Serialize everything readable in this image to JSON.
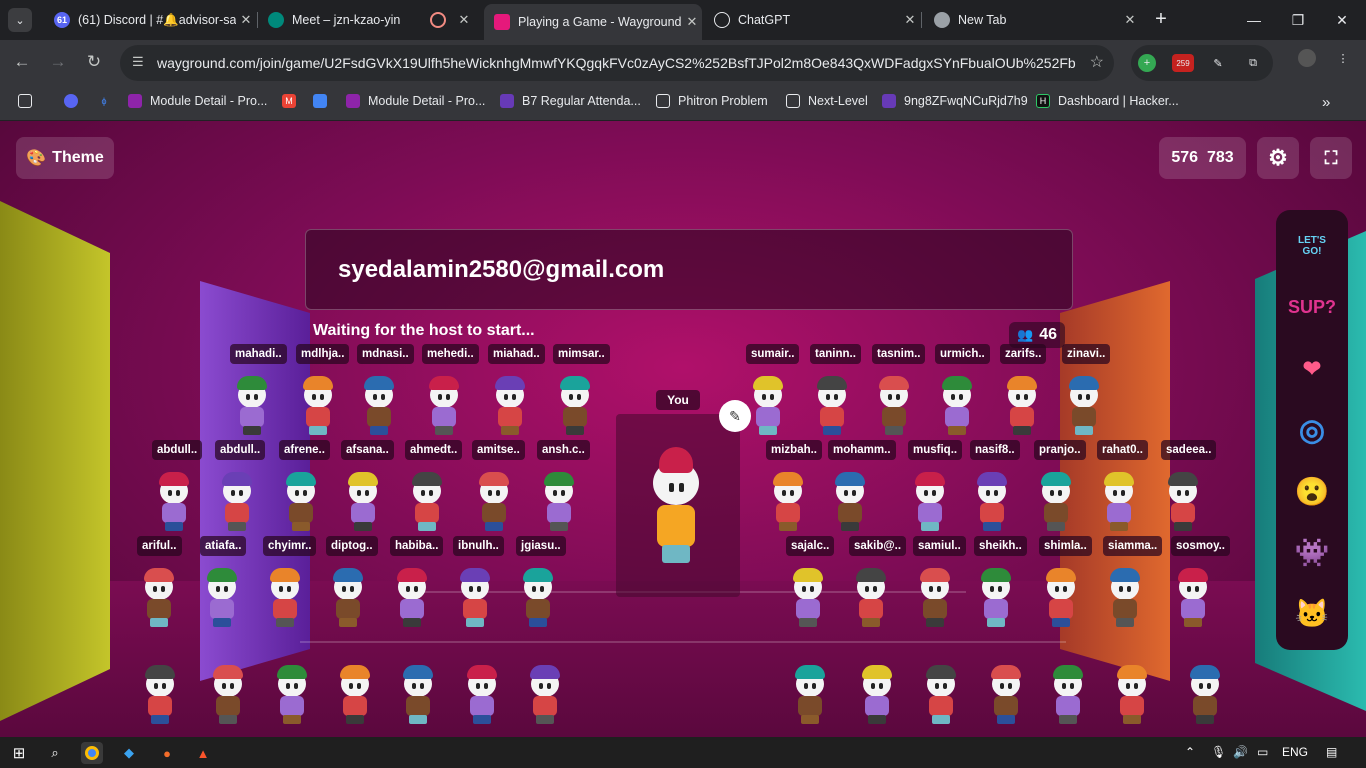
{
  "browser": {
    "tabs": [
      {
        "title": "(61) Discord | #🔔advisor-sa",
        "icon": "discord-icon",
        "badge": "61"
      },
      {
        "title": "Meet – jzn-kzao-yin",
        "icon": "meet-icon"
      },
      {
        "title": "",
        "icon": "recording-icon"
      },
      {
        "title": "Playing a Game - Wayground",
        "icon": "wayground-icon",
        "active": true
      },
      {
        "title": "ChatGPT",
        "icon": "chatgpt-icon"
      },
      {
        "title": "New Tab",
        "icon": "chrome-icon"
      }
    ],
    "url": "wayground.com/join/game/U2FsdGVkX19Ulfh5heWicknhgMmwfYKQgqkFVc0zAyCS2%252BsfTJPol2m8Oe843QxWDFadgxSYnFbualOUb%252FbIdn...",
    "extension_badge": "259",
    "bookmarks": [
      {
        "label": "",
        "icon": "apps-grid-icon"
      },
      {
        "label": "",
        "icon": "discord-icon"
      },
      {
        "label": "",
        "icon": "leetcode-icon"
      },
      {
        "label": "Module Detail - Pro...",
        "icon": "module-icon"
      },
      {
        "label": "",
        "icon": "gmail-icon"
      },
      {
        "label": "",
        "icon": "chart-icon"
      },
      {
        "label": "Module Detail - Pro...",
        "icon": "module-icon"
      },
      {
        "label": "B7 Regular Attenda...",
        "icon": "form-icon"
      },
      {
        "label": "Phitron Problem",
        "icon": "folder-icon"
      },
      {
        "label": "Next-Level",
        "icon": "folder-icon"
      },
      {
        "label": "9ng8ZFwqNCuRjd7h9",
        "icon": "form-icon"
      },
      {
        "label": "Dashboard | Hacker...",
        "icon": "hackerrank-icon"
      }
    ]
  },
  "game": {
    "theme_label": "Theme",
    "game_code": "576  783",
    "player_name": "syedalamin2580@gmail.com",
    "status": "Waiting for the host to start...",
    "player_count": "46",
    "you_label": "You",
    "players": [
      "mahadi..",
      "mdlhja..",
      "mdnasi..",
      "mehedi..",
      "miahad..",
      "mimsar..",
      "sumair..",
      "taninn..",
      "tasnim..",
      "urmich..",
      "zarifs..",
      "zinavi..",
      "abdull..",
      "abdull..",
      "afrene..",
      "afsana..",
      "ahmedt..",
      "amitse..",
      "ansh.c..",
      "mizbah..",
      "mohamm..",
      "musfiq..",
      "nasif8..",
      "pranjo..",
      "rahat0..",
      "sadeea..",
      "ariful..",
      "atiafa..",
      "chyimr..",
      "diptog..",
      "habiba..",
      "ibnulh..",
      "jgiasu..",
      "sajalc..",
      "sakib@..",
      "samiul..",
      "sheikh..",
      "shimla..",
      "siamma..",
      "sosmoy.."
    ],
    "reactions": [
      "LET'S GO!",
      "SUP?",
      "❤",
      "◎",
      "😮",
      "👾",
      "🐱"
    ]
  },
  "taskbar": {
    "language": "ENG"
  },
  "colors": {
    "accent": "#b0106a",
    "panel": "#2a0a20"
  }
}
